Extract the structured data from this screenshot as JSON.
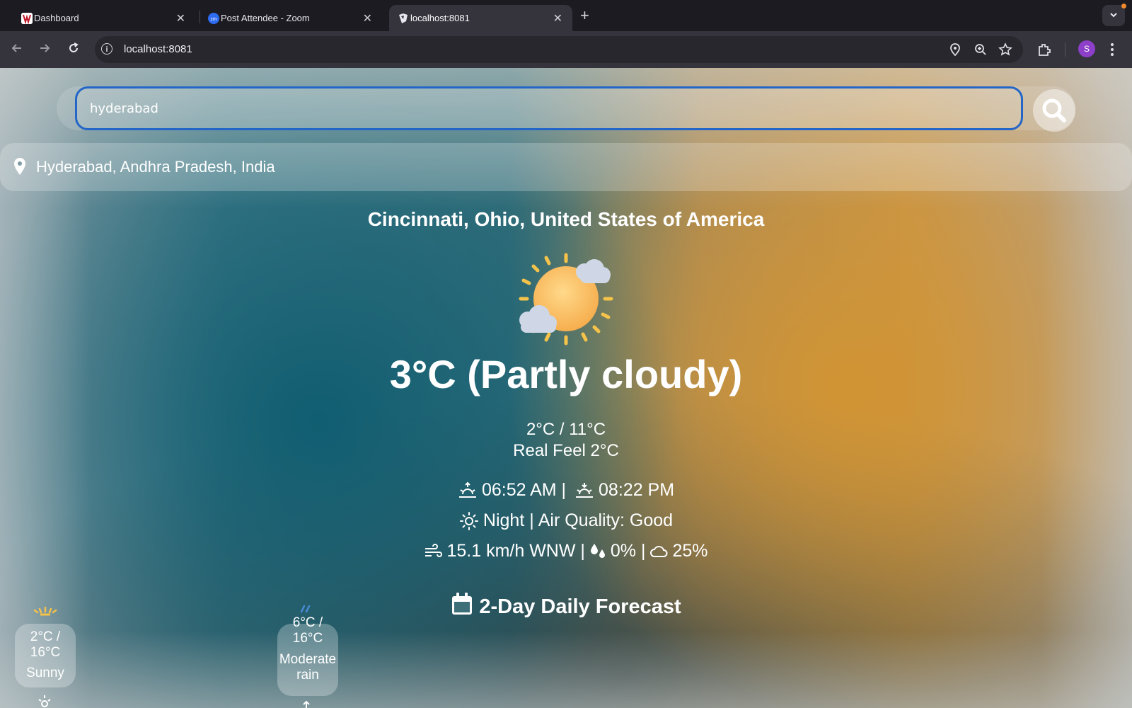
{
  "browser": {
    "tabs": [
      {
        "title": "Dashboard",
        "favicon": "university-logo-icon",
        "active": false
      },
      {
        "title": "Post Attendee - Zoom",
        "favicon": "zoom-icon",
        "active": false
      },
      {
        "title": "localhost:8081",
        "favicon": "app-icon",
        "active": true
      }
    ],
    "url": "localhost:8081",
    "profile_initial": "S",
    "accent": "#2466c8"
  },
  "search": {
    "value": "hyderabad",
    "suggestion": "Hyderabad, Andhra Pradesh, India"
  },
  "current": {
    "location": "Cincinnati, Ohio, United States of America",
    "icon": "partly-cloudy-icon",
    "headline": "3°C (Partly cloudy)",
    "range": "2°C / 11°C",
    "real_feel": "Real Feel 2°C",
    "sunrise": "06:52 AM |",
    "sunset": "08:22 PM",
    "day_night": "Night |",
    "air_quality": "Air Quality: Good",
    "wind": "15.1 km/h WNW |",
    "precip": "0% |",
    "cloud_cover": "25%"
  },
  "forecast": {
    "title": "2-Day Daily Forecast",
    "days": [
      {
        "range": "2°C / 16°C",
        "condition": "Sunny",
        "icon": "sun-icon"
      },
      {
        "range": "6°C / 16°C",
        "condition": "Moderate rain",
        "icon": "rain-icon"
      }
    ]
  }
}
